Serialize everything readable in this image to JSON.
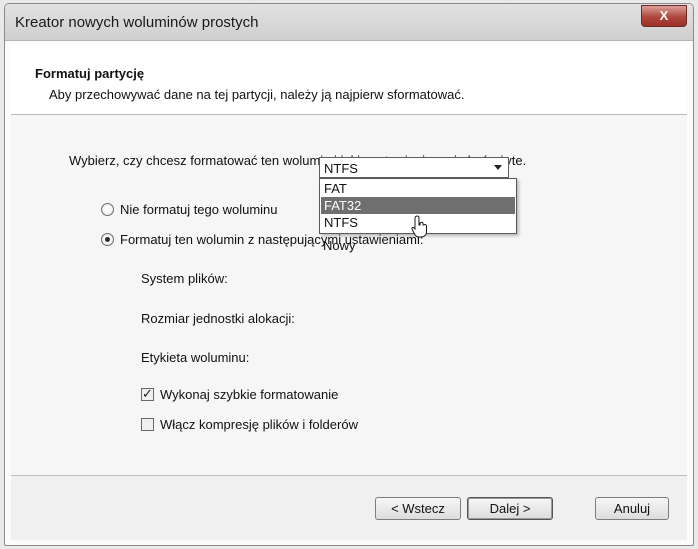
{
  "window": {
    "title": "Kreator nowych woluminów prostych",
    "close_label": "X"
  },
  "header": {
    "title": "Formatuj partycję",
    "subtitle": "Aby przechowywać dane na tej partycji, należy ją najpierw sformatować."
  },
  "content": {
    "instruction": "Wybierz, czy chcesz formatować ten wolumin i jakie ustawienia mają być użyte.",
    "radio_no_format": "Nie formatuj tego woluminu",
    "radio_format": "Formatuj ten wolumin z następującymi ustawieniami:",
    "selected_radio": "format",
    "filesystem_label": "System plików:",
    "filesystem_value": "NTFS",
    "filesystem_options": [
      "FAT",
      "FAT32",
      "NTFS"
    ],
    "highlighted_option": "FAT32",
    "allocation_label": "Rozmiar jednostki alokacji:",
    "volume_label_label": "Etykieta woluminu:",
    "volume_label_value": "Nowy",
    "quick_format_label": "Wykonaj szybkie formatowanie",
    "quick_format_checked": true,
    "compression_label": "Włącz kompresję plików i folderów",
    "compression_checked": false
  },
  "footer": {
    "back": "< Wstecz",
    "next": "Dalej >",
    "cancel": "Anuluj"
  }
}
